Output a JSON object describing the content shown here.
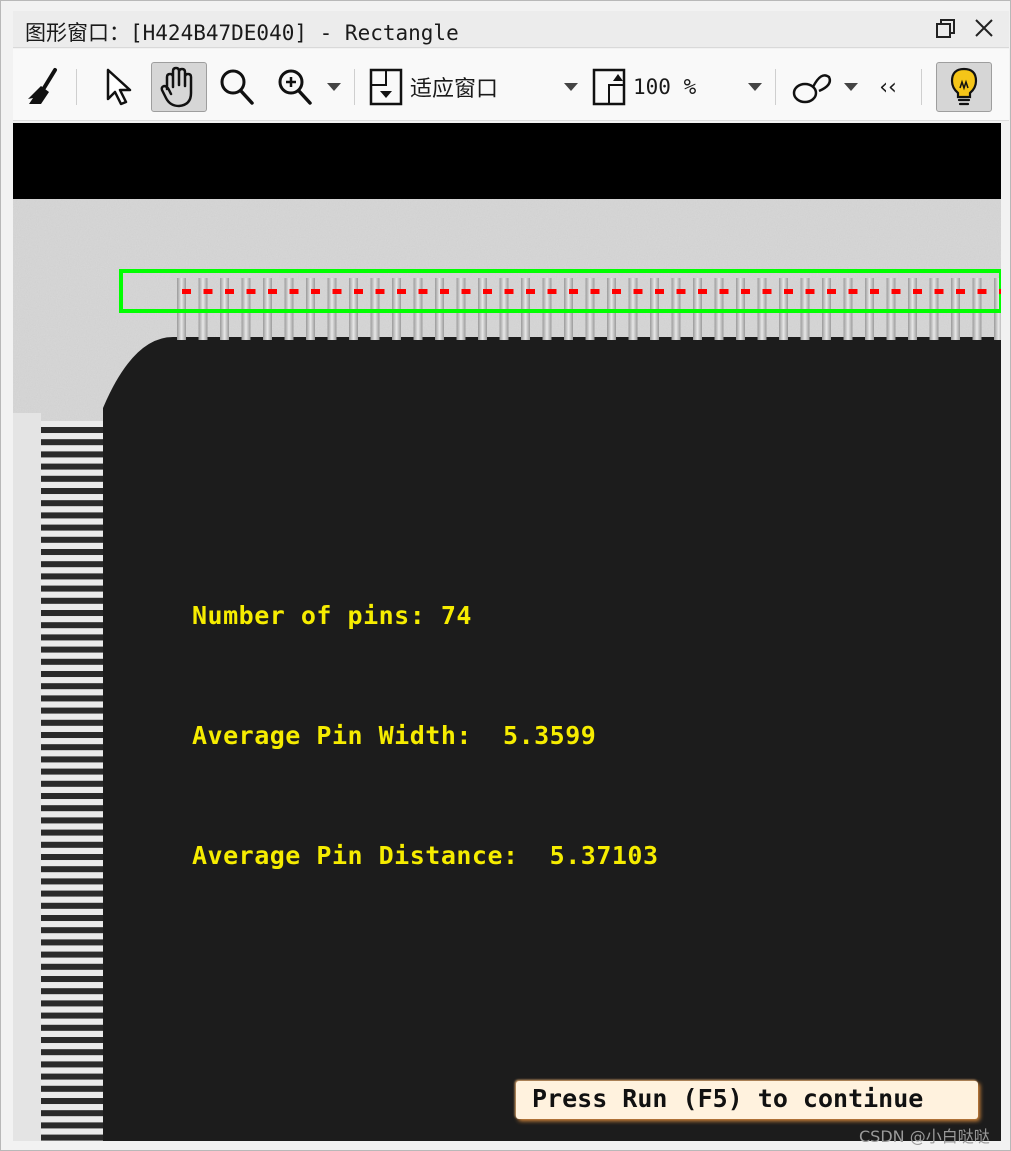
{
  "window": {
    "title": "图形窗口：[H424B47DE040] - Rectangle"
  },
  "toolbar": {
    "clear_icon": "broom-icon",
    "select_icon": "pointer-icon",
    "pan_icon": "hand-icon",
    "zoom_icon": "magnifier-icon",
    "zoom_in_icon": "zoom-in-icon",
    "fit_label": "适应窗口",
    "zoom_level": "100 %",
    "draw_icon": "shape-draw-icon",
    "collapse_label": "‹‹",
    "hint_icon": "lightbulb-icon"
  },
  "overlay": {
    "pins_text": "Number of pins: 74",
    "width_text": "Average Pin Width:  5.3599",
    "distance_text": "Average Pin Distance:  5.37103",
    "continue_text": "Press Run (F5) to continue"
  },
  "measurements": {
    "number_of_pins": 74,
    "average_pin_width": 5.3599,
    "average_pin_distance": 5.37103
  },
  "colors": {
    "roi_rectangle": "#00ff00",
    "pin_markers": "#ff0000",
    "overlay_text": "#f6ec00",
    "button_glow": "#d98a3c"
  },
  "watermark": "CSDN @小白哒哒"
}
